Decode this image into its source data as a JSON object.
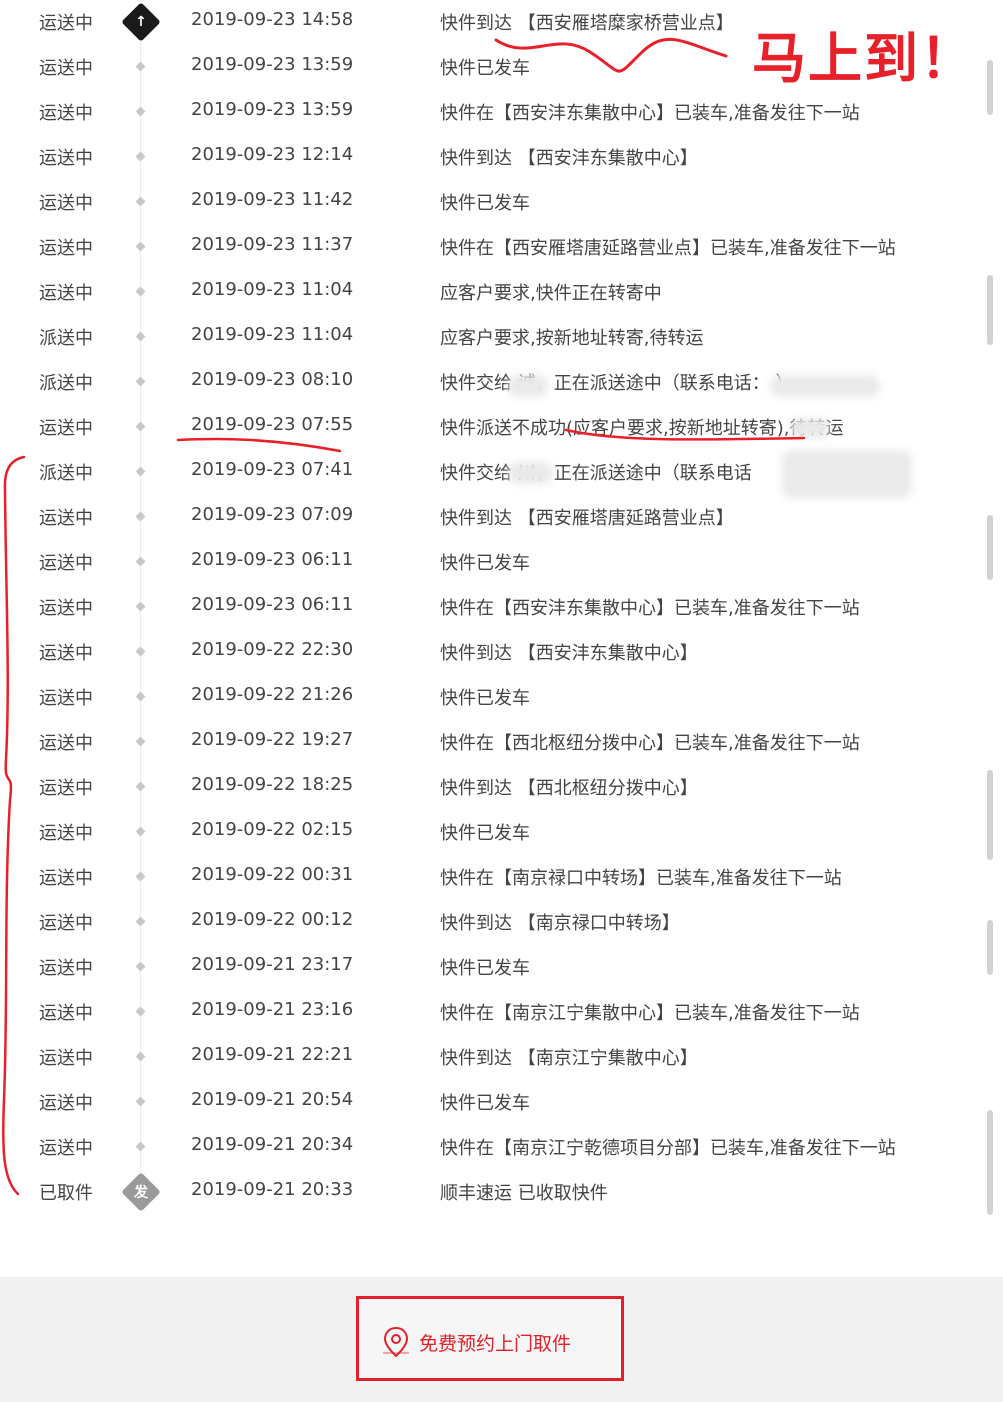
{
  "events": [
    {
      "status": "运送中",
      "time": "2019-09-23 14:58",
      "desc": "快件到达 【西安雁塔糜家桥营业点】",
      "marker": "up"
    },
    {
      "status": "运送中",
      "time": "2019-09-23 13:59",
      "desc": "快件已发车",
      "marker": "dot"
    },
    {
      "status": "运送中",
      "time": "2019-09-23 13:59",
      "desc": "快件在【西安沣东集散中心】已装车,准备发往下一站",
      "marker": "dot"
    },
    {
      "status": "运送中",
      "time": "2019-09-23 12:14",
      "desc": "快件到达 【西安沣东集散中心】",
      "marker": "dot"
    },
    {
      "status": "运送中",
      "time": "2019-09-23 11:42",
      "desc": "快件已发车",
      "marker": "dot"
    },
    {
      "status": "运送中",
      "time": "2019-09-23 11:37",
      "desc": "快件在【西安雁塔唐延路营业点】已装车,准备发往下一站",
      "marker": "dot"
    },
    {
      "status": "运送中",
      "time": "2019-09-23 11:04",
      "desc": "应客户要求,快件正在转寄中",
      "marker": "dot"
    },
    {
      "status": "派送中",
      "time": "2019-09-23 11:04",
      "desc": "应客户要求,按新地址转寄,待转运",
      "marker": "dot"
    },
    {
      "status": "派送中",
      "time": "2019-09-23 08:10",
      "desc": "快件交给   诚，正在派送途中（联系电话：                 ）",
      "marker": "dot"
    },
    {
      "status": "运送中",
      "time": "2019-09-23 07:55",
      "desc": "快件派送不成功(应客户要求,按新地址转寄),待转运",
      "marker": "dot"
    },
    {
      "status": "派送中",
      "time": "2019-09-23 07:41",
      "desc": "快件交给   川，正在派送途中（联系电话",
      "marker": "dot"
    },
    {
      "status": "运送中",
      "time": "2019-09-23 07:09",
      "desc": "快件到达 【西安雁塔唐延路营业点】",
      "marker": "dot"
    },
    {
      "status": "运送中",
      "time": "2019-09-23 06:11",
      "desc": "快件已发车",
      "marker": "dot"
    },
    {
      "status": "运送中",
      "time": "2019-09-23 06:11",
      "desc": "快件在【西安沣东集散中心】已装车,准备发往下一站",
      "marker": "dot"
    },
    {
      "status": "运送中",
      "time": "2019-09-22 22:30",
      "desc": "快件到达 【西安沣东集散中心】",
      "marker": "dot"
    },
    {
      "status": "运送中",
      "time": "2019-09-22 21:26",
      "desc": "快件已发车",
      "marker": "dot"
    },
    {
      "status": "运送中",
      "time": "2019-09-22 19:27",
      "desc": "快件在【西北枢纽分拨中心】已装车,准备发往下一站",
      "marker": "dot"
    },
    {
      "status": "运送中",
      "time": "2019-09-22 18:25",
      "desc": "快件到达 【西北枢纽分拨中心】",
      "marker": "dot"
    },
    {
      "status": "运送中",
      "time": "2019-09-22 02:15",
      "desc": "快件已发车",
      "marker": "dot"
    },
    {
      "status": "运送中",
      "time": "2019-09-22 00:31",
      "desc": "快件在【南京禄口中转场】已装车,准备发往下一站",
      "marker": "dot"
    },
    {
      "status": "运送中",
      "time": "2019-09-22 00:12",
      "desc": "快件到达 【南京禄口中转场】",
      "marker": "dot"
    },
    {
      "status": "运送中",
      "time": "2019-09-21 23:17",
      "desc": "快件已发车",
      "marker": "dot"
    },
    {
      "status": "运送中",
      "time": "2019-09-21 23:16",
      "desc": "快件在【南京江宁集散中心】已装车,准备发往下一站",
      "marker": "dot"
    },
    {
      "status": "运送中",
      "time": "2019-09-21 22:21",
      "desc": "快件到达 【南京江宁集散中心】",
      "marker": "dot"
    },
    {
      "status": "运送中",
      "time": "2019-09-21 20:54",
      "desc": "快件已发车",
      "marker": "dot"
    },
    {
      "status": "运送中",
      "time": "2019-09-21 20:34",
      "desc": "快件在【南京江宁乾德项目分部】已装车,准备发往下一站",
      "marker": "dot"
    },
    {
      "status": "已取件",
      "time": "2019-09-21 20:33",
      "desc": "顺丰速运 已收取快件",
      "marker": "fa"
    }
  ],
  "marker_glyphs": {
    "up": "↑",
    "fa": "发"
  },
  "annotation": {
    "text": "马上到！",
    "color": "#e8202a"
  },
  "footer": {
    "pickup_button": "免费预约上门取件",
    "pickup_icon": "location-pin-icon"
  },
  "colors": {
    "accent": "#e0202a",
    "marker_dark": "#1a1a1a",
    "marker_gray": "#9a9a9a"
  }
}
